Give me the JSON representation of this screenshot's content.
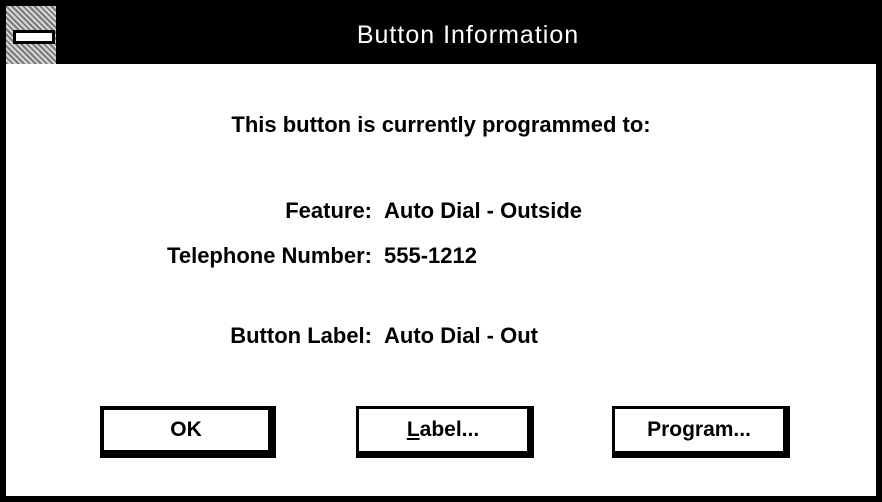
{
  "window": {
    "title": "Button Information",
    "system_menu_icon": "system-menu-icon"
  },
  "content": {
    "heading": "This button is currently programmed to:",
    "fields": {
      "feature": {
        "label": "Feature:",
        "value": "Auto Dial - Outside"
      },
      "telephone_number": {
        "label": "Telephone Number:",
        "value": "555-1212"
      },
      "button_label": {
        "label": "Button Label:",
        "value": "Auto Dial - Out"
      }
    }
  },
  "buttons": {
    "ok": "OK",
    "label_mnemonic": "L",
    "label_rest": "abel...",
    "program": "Program..."
  }
}
